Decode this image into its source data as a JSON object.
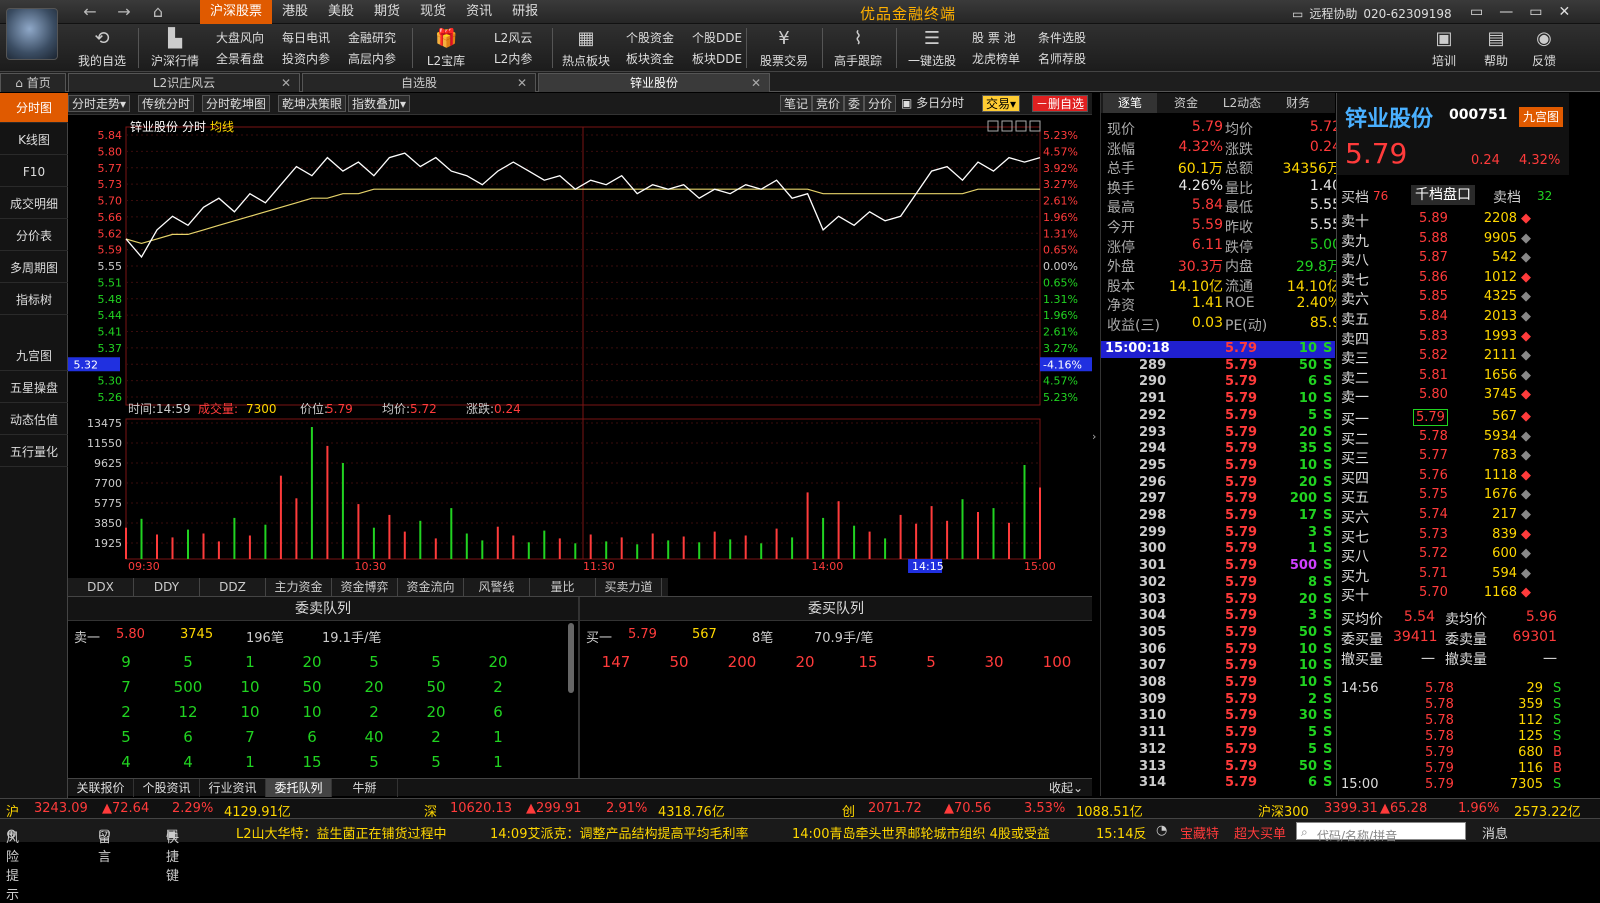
{
  "app": {
    "title": "优品金融终端",
    "remote": "远程协助",
    "phone": "020-62309198",
    "win": [
      "▭",
      "—",
      "▭",
      "✕"
    ]
  },
  "nav": {
    "back": "←",
    "forward": "→",
    "home": "⌂"
  },
  "topmenu": [
    {
      "label": "沪深股票",
      "active": true
    },
    {
      "label": "港股"
    },
    {
      "label": "美股"
    },
    {
      "label": "期货"
    },
    {
      "label": "现货"
    },
    {
      "label": "资讯"
    },
    {
      "label": "研报"
    }
  ],
  "toolbar": {
    "my_watch": "我的自选",
    "market": "沪深行情",
    "pair1": [
      "大盘风向",
      "全景看盘"
    ],
    "pair2": [
      "每日电讯",
      "投资内参"
    ],
    "pair3": [
      "金融研究",
      "高层内参"
    ],
    "l2lib": "L2宝库",
    "pair4": [
      "L2风云",
      "L2内参"
    ],
    "hot": "热点板块",
    "pair5": [
      "个股资金",
      "板块资金"
    ],
    "pair6": [
      "个股DDE",
      "板块DDE"
    ],
    "trade": "股票交易",
    "master": "高手跟踪",
    "select": "一键选股",
    "pair7": [
      "股 票 池",
      "龙虎榜单"
    ],
    "pair8": [
      "条件选股",
      "名师荐股"
    ],
    "train": "培训",
    "help": "帮助",
    "feedback": "反馈"
  },
  "tabs": [
    {
      "label": "首页"
    },
    {
      "label": "L2识庄风云"
    },
    {
      "label": "自选股"
    },
    {
      "label": "锌业股份",
      "active": true
    }
  ],
  "sidebar": [
    "分时图",
    "K线图",
    "F10",
    "成交明细",
    "分价表",
    "多周期图",
    "指标树",
    "九宫图",
    "五星操盘",
    "动态估值",
    "五行量化"
  ],
  "chartctl": {
    "left": [
      "分时走势▾",
      "传统分时",
      "分时乾坤图",
      "乾坤决策眼",
      "指数叠加▾"
    ],
    "right": [
      "笔记",
      "竞价",
      "委",
      "分价"
    ],
    "multi": "多日分时",
    "trade": "交易▾",
    "delwatch": "－删自选"
  },
  "chart": {
    "stock": "锌业股份",
    "mode": "分时",
    "avg_label": "均线",
    "left_ticks": [
      "5.84",
      "5.80",
      "5.77",
      "5.73",
      "5.70",
      "5.66",
      "5.62",
      "5.59",
      "5.55",
      "5.51",
      "5.48",
      "5.44",
      "5.41",
      "5.37",
      "5.32",
      "5.30",
      "5.26"
    ],
    "right_ticks": [
      "5.23%",
      "4.57%",
      "3.92%",
      "3.27%",
      "2.61%",
      "1.96%",
      "1.31%",
      "0.65%",
      "0.00%",
      "0.65%",
      "1.31%",
      "1.96%",
      "2.61%",
      "3.27%",
      "-4.16%",
      "4.57%",
      "5.23%"
    ],
    "info": {
      "time_label": "时间:",
      "time": "14:59",
      "vol_label": "成交量:",
      "vol": "7300",
      "price_label": "价位:",
      "price": "5.79",
      "avg_label": "均价:",
      "avg": "5.72",
      "chg_label": "涨跌:",
      "chg": "0.24"
    },
    "vol_ticks": [
      "13475",
      "11550",
      "9625",
      "7700",
      "5775",
      "3850",
      "1925"
    ],
    "x_ticks": [
      "09:30",
      "10:30",
      "11:30",
      "14:00",
      "14:15",
      "15:00"
    ]
  },
  "chart_data": {
    "type": "line",
    "title": "锌业股份 分时",
    "prev_close": 5.55,
    "ylim": [
      5.26,
      5.84
    ],
    "price": [
      5.61,
      5.57,
      5.63,
      5.66,
      5.64,
      5.68,
      5.7,
      5.67,
      5.71,
      5.69,
      5.73,
      5.77,
      5.75,
      5.79,
      5.76,
      5.78,
      5.75,
      5.79,
      5.8,
      5.77,
      5.79,
      5.76,
      5.75,
      5.73,
      5.76,
      5.78,
      5.76,
      5.74,
      5.75,
      5.72,
      5.74,
      5.73,
      5.75,
      5.71,
      5.73,
      5.72,
      5.73,
      5.7,
      5.72,
      5.71,
      5.73,
      5.72,
      5.74,
      5.7,
      5.71,
      5.63,
      5.66,
      5.64,
      5.67,
      5.65,
      5.66,
      5.71,
      5.76,
      5.77,
      5.74,
      5.78,
      5.76,
      5.79,
      5.78,
      5.79
    ],
    "avg": [
      5.61,
      5.6,
      5.61,
      5.62,
      5.62,
      5.63,
      5.64,
      5.65,
      5.66,
      5.67,
      5.68,
      5.69,
      5.7,
      5.7,
      5.71,
      5.71,
      5.72,
      5.72,
      5.72,
      5.72,
      5.72,
      5.72,
      5.72,
      5.72,
      5.72,
      5.72,
      5.72,
      5.72,
      5.72,
      5.72,
      5.72,
      5.72,
      5.72,
      5.72,
      5.72,
      5.72,
      5.72,
      5.72,
      5.72,
      5.72,
      5.72,
      5.72,
      5.72,
      5.72,
      5.72,
      5.71,
      5.71,
      5.71,
      5.71,
      5.71,
      5.71,
      5.71,
      5.71,
      5.71,
      5.71,
      5.72,
      5.72,
      5.72,
      5.72,
      5.72
    ],
    "volume": [
      3200,
      4100,
      2500,
      2200,
      3000,
      2600,
      1800,
      4200,
      2400,
      3500,
      8500,
      6200,
      13475,
      11550,
      9800,
      5600,
      3200,
      4500,
      2800,
      3900,
      2100,
      5200,
      2600,
      1900,
      3300,
      2400,
      1700,
      2900,
      2100,
      1600,
      2500,
      1800,
      2200,
      1500,
      2600,
      1900,
      2300,
      1700,
      2800,
      2000,
      2400,
      1600,
      3100,
      2200,
      6800,
      4200,
      5900,
      3400,
      2800,
      2100,
      4500,
      3600,
      5400,
      3900,
      6100,
      4800,
      5200,
      3700,
      9600,
      7300
    ]
  },
  "indtabs": [
    "DDX",
    "DDY",
    "DDZ",
    "主力资金",
    "资金博弈",
    "资金流向",
    "风警线",
    "量比",
    "买卖力道"
  ],
  "queue": {
    "sell_title": "委卖队列",
    "buy_title": "委买队列",
    "sell_head": {
      "label": "卖一",
      "price": "5.80",
      "vol": "3745",
      "count": "196笔",
      "avg": "19.1手/笔"
    },
    "buy_head": {
      "label": "买一",
      "price": "5.79",
      "vol": "567",
      "count": "8笔",
      "avg": "70.9手/笔"
    },
    "sell_rows": [
      [
        "9",
        "5",
        "1",
        "20",
        "5",
        "5",
        "20"
      ],
      [
        "7",
        "500",
        "10",
        "50",
        "20",
        "50",
        "2"
      ],
      [
        "2",
        "12",
        "10",
        "10",
        "2",
        "20",
        "6"
      ],
      [
        "5",
        "6",
        "7",
        "6",
        "40",
        "2",
        "1"
      ],
      [
        "4",
        "4",
        "1",
        "15",
        "5",
        "5",
        "1"
      ]
    ],
    "buy_rows": [
      [
        "147",
        "50",
        "200",
        "20",
        "15",
        "5",
        "30",
        "100"
      ]
    ]
  },
  "bottomtabs": [
    "关联报价",
    "个股资讯",
    "行业资讯",
    "委托队列",
    "牛掰"
  ],
  "collapse": "收起⌄",
  "quote": {
    "tabs": [
      "逐笔",
      "资金",
      "L2动态",
      "财务"
    ],
    "rows": [
      [
        {
          "k": "现价",
          "v": "5.79",
          "c": "red"
        },
        {
          "k": "均价",
          "v": "5.72",
          "c": "red"
        }
      ],
      [
        {
          "k": "涨幅",
          "v": "4.32%",
          "c": "red"
        },
        {
          "k": "涨跌",
          "v": "0.24",
          "c": "red"
        }
      ],
      [
        {
          "k": "总手",
          "v": "60.1万",
          "c": "yel"
        },
        {
          "k": "总额",
          "v": "34356万",
          "c": "yel"
        }
      ],
      [
        {
          "k": "换手",
          "v": "4.26%",
          "c": "wht"
        },
        {
          "k": "量比",
          "v": "1.40",
          "c": "wht"
        }
      ],
      [
        {
          "k": "最高",
          "v": "5.84",
          "c": "red"
        },
        {
          "k": "最低",
          "v": "5.55",
          "c": "wht"
        }
      ],
      [
        {
          "k": "今开",
          "v": "5.59",
          "c": "red"
        },
        {
          "k": "昨收",
          "v": "5.55",
          "c": "wht"
        }
      ],
      [
        {
          "k": "涨停",
          "v": "6.11",
          "c": "red"
        },
        {
          "k": "跌停",
          "v": "5.00",
          "c": "grn"
        }
      ],
      [
        {
          "k": "外盘",
          "v": "30.3万",
          "c": "red"
        },
        {
          "k": "内盘",
          "v": "29.8万",
          "c": "grn"
        }
      ],
      [
        {
          "k": "股本",
          "v": "14.10亿",
          "c": "yel"
        },
        {
          "k": "流通",
          "v": "14.10亿",
          "c": "yel"
        }
      ],
      [
        {
          "k": "净资",
          "v": "1.41",
          "c": "yel"
        },
        {
          "k": "ROE",
          "v": "2.40%",
          "c": "yel"
        }
      ],
      [
        {
          "k": "收益(三)",
          "v": "0.03",
          "c": "yel"
        },
        {
          "k": "PE(动)",
          "v": "85.9",
          "c": "yel"
        }
      ]
    ],
    "ticks": [
      [
        "15:00:18",
        "5.79",
        "10",
        "S"
      ],
      [
        "289",
        "5.79",
        "50",
        "S"
      ],
      [
        "290",
        "5.79",
        "6",
        "S"
      ],
      [
        "291",
        "5.79",
        "10",
        "S"
      ],
      [
        "292",
        "5.79",
        "5",
        "S"
      ],
      [
        "293",
        "5.79",
        "20",
        "S"
      ],
      [
        "294",
        "5.79",
        "35",
        "S"
      ],
      [
        "295",
        "5.79",
        "10",
        "S"
      ],
      [
        "296",
        "5.79",
        "20",
        "S"
      ],
      [
        "297",
        "5.79",
        "200",
        "S"
      ],
      [
        "298",
        "5.79",
        "17",
        "S"
      ],
      [
        "299",
        "5.79",
        "3",
        "S"
      ],
      [
        "300",
        "5.79",
        "1",
        "S"
      ],
      [
        "301",
        "5.79",
        "500",
        "S"
      ],
      [
        "302",
        "5.79",
        "8",
        "S"
      ],
      [
        "303",
        "5.79",
        "20",
        "S"
      ],
      [
        "304",
        "5.79",
        "3",
        "S"
      ],
      [
        "305",
        "5.79",
        "50",
        "S"
      ],
      [
        "306",
        "5.79",
        "10",
        "S"
      ],
      [
        "307",
        "5.79",
        "10",
        "S"
      ],
      [
        "308",
        "5.79",
        "10",
        "S"
      ],
      [
        "309",
        "5.79",
        "2",
        "S"
      ],
      [
        "310",
        "5.79",
        "30",
        "S"
      ],
      [
        "311",
        "5.79",
        "5",
        "S"
      ],
      [
        "312",
        "5.79",
        "5",
        "S"
      ],
      [
        "313",
        "5.79",
        "50",
        "S"
      ],
      [
        "314",
        "5.79",
        "6",
        "S"
      ]
    ]
  },
  "orderbook": {
    "name": "锌业股份",
    "code": "000751",
    "grid": "九宫图",
    "price": "5.79",
    "chg": "0.24",
    "pct": "4.32%",
    "sell_label": "买档",
    "sell_count": "76",
    "mid": "千档盘口",
    "buy_label": "卖档",
    "buy_count": "32",
    "asks": [
      [
        "卖十",
        "5.89",
        "2208"
      ],
      [
        "卖九",
        "5.88",
        "9905"
      ],
      [
        "卖八",
        "5.87",
        "542"
      ],
      [
        "卖七",
        "5.86",
        "1012"
      ],
      [
        "卖六",
        "5.85",
        "4325"
      ],
      [
        "卖五",
        "5.84",
        "2013"
      ],
      [
        "卖四",
        "5.83",
        "1993"
      ],
      [
        "卖三",
        "5.82",
        "2111"
      ],
      [
        "卖二",
        "5.81",
        "1656"
      ],
      [
        "卖一",
        "5.80",
        "3745"
      ]
    ],
    "bids": [
      [
        "买一",
        "5.79",
        "567"
      ],
      [
        "买二",
        "5.78",
        "5934"
      ],
      [
        "买三",
        "5.77",
        "783"
      ],
      [
        "买四",
        "5.76",
        "1118"
      ],
      [
        "买五",
        "5.75",
        "1676"
      ],
      [
        "买六",
        "5.74",
        "217"
      ],
      [
        "买七",
        "5.73",
        "839"
      ],
      [
        "买八",
        "5.72",
        "600"
      ],
      [
        "买九",
        "5.71",
        "594"
      ],
      [
        "买十",
        "5.70",
        "1168"
      ]
    ],
    "stats": [
      [
        "买均价",
        "5.54",
        "卖均价",
        "5.96"
      ],
      [
        "委买量",
        "39411",
        "委卖量",
        "69301"
      ],
      [
        "撤买量",
        "一",
        "撤卖量",
        "一"
      ]
    ],
    "trades": [
      [
        "14:56",
        "5.78",
        "29",
        "S"
      ],
      [
        "",
        "5.78",
        "359",
        "S"
      ],
      [
        "",
        "5.78",
        "112",
        "S"
      ],
      [
        "",
        "5.78",
        "125",
        "S"
      ],
      [
        "",
        "5.79",
        "680",
        "B"
      ],
      [
        "",
        "5.79",
        "116",
        "B"
      ],
      [
        "15:00",
        "5.79",
        "7305",
        "S"
      ]
    ]
  },
  "status": {
    "sh": [
      "沪",
      "3243.09",
      "▲72.64",
      "2.29%",
      "4129.91亿"
    ],
    "sz": [
      "深",
      "10620.13",
      "▲299.91",
      "2.91%",
      "4318.76亿"
    ],
    "cy": [
      "创",
      "2071.72",
      "▲70.56",
      "3.53%",
      "1088.51亿"
    ],
    "hs300": [
      "沪深300",
      "3399.31",
      "▲65.28",
      "1.96%",
      "2573.22亿"
    ]
  },
  "news": {
    "risk": "风险提示",
    "msg": "留言",
    "shortcut": "快捷键",
    "items": [
      "L2山大华特：益生菌正在铺货过程中",
      "14:09艾派克：调整产品结构提高平均毛利率",
      "14:00青岛牵头世界邮轮城市组织 4股或受益",
      "15:14反"
    ],
    "tools": [
      "宝藏特",
      "超大买单"
    ],
    "search": "代码/名称/拼音",
    "msgcenter": "消息"
  }
}
